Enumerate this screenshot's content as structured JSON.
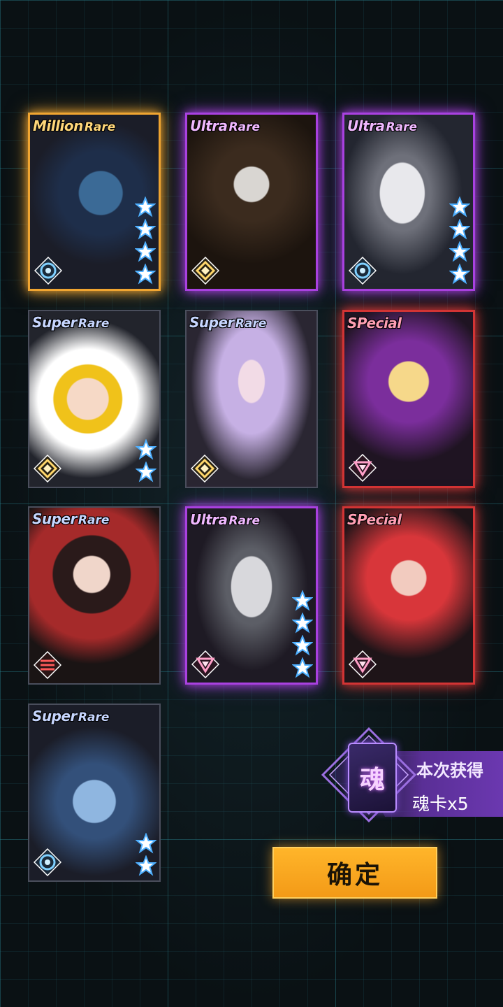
{
  "cards": [
    {
      "rarity_word1": "Million",
      "rarity_word2": "Rare",
      "tier": "million",
      "stars": 4,
      "emblem": "circle-emblem-icon"
    },
    {
      "rarity_word1": "Ultra",
      "rarity_word2": "Rare",
      "tier": "ultra",
      "stars": 0,
      "emblem": "diamond-emblem-icon"
    },
    {
      "rarity_word1": "Ultra",
      "rarity_word2": "Rare",
      "tier": "ultra",
      "stars": 4,
      "emblem": "circle-emblem-icon"
    },
    {
      "rarity_word1": "Super",
      "rarity_word2": "Rare",
      "tier": "super",
      "stars": 2,
      "emblem": "diamond-emblem-icon"
    },
    {
      "rarity_word1": "Super",
      "rarity_word2": "Rare",
      "tier": "super",
      "stars": 0,
      "emblem": "diamond-emblem-icon"
    },
    {
      "rarity_word1": "SPecial",
      "rarity_word2": "",
      "tier": "special",
      "stars": 0,
      "emblem": "triangle-emblem-icon"
    },
    {
      "rarity_word1": "Super",
      "rarity_word2": "Rare",
      "tier": "super",
      "stars": 0,
      "emblem": "stripes-emblem-icon"
    },
    {
      "rarity_word1": "Ultra",
      "rarity_word2": "Rare",
      "tier": "ultra",
      "stars": 4,
      "emblem": "triangle-emblem-icon"
    },
    {
      "rarity_word1": "SPecial",
      "rarity_word2": "",
      "tier": "special",
      "stars": 0,
      "emblem": "triangle-emblem-icon"
    },
    {
      "rarity_word1": "Super",
      "rarity_word2": "Rare",
      "tier": "super",
      "stars": 2,
      "emblem": "circle-emblem-icon"
    }
  ],
  "reward": {
    "card_glyph": "魂",
    "title": "本次获得",
    "count": "魂卡x5"
  },
  "confirm_label": "确定",
  "colors": {
    "million": "#f0a531",
    "ultra": "#a941e0",
    "special": "#d23434",
    "confirm": "#f8a51e"
  }
}
